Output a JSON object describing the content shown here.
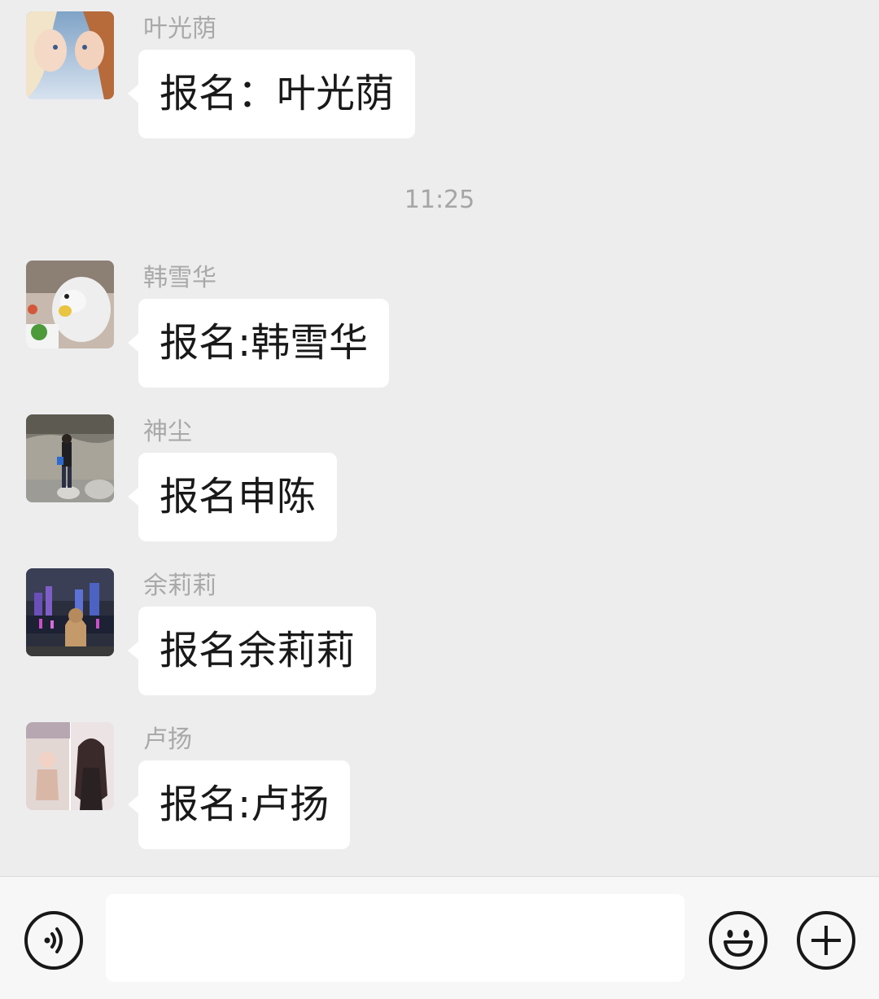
{
  "messages": [
    {
      "sender": "叶光荫",
      "text": "报名：叶光荫"
    },
    {
      "sender": "韩雪华",
      "text": "报名:韩雪华"
    },
    {
      "sender": "神尘",
      "text": "报名申陈"
    },
    {
      "sender": "余莉莉",
      "text": "报名余莉莉"
    },
    {
      "sender": "卢扬",
      "text": "报名:卢扬"
    }
  ],
  "timestamp": "11:25",
  "input_bar": {
    "text_value": "",
    "voice_icon": "voice-icon",
    "emoji_icon": "emoji-icon",
    "add_icon": "add-icon"
  },
  "colors": {
    "background": "#ededed",
    "bubble": "#ffffff",
    "sender_name": "#a9a9a9",
    "message_text": "#191919"
  }
}
